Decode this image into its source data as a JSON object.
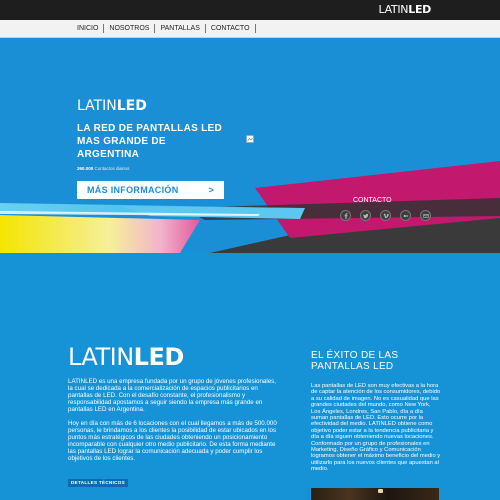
{
  "header": {
    "brand_light": "LATIN",
    "brand_bold": "LED",
    "nav": [
      "INICIO",
      "NOSOTROS",
      "PANTALLAS",
      "CONTACTO"
    ]
  },
  "hero": {
    "logo_light": "LATIN",
    "logo_bold": "LED",
    "title": "LA RED DE PANTALLAS LED MAS  GRANDE DE ARGENTINA",
    "counter_value": "260.000",
    "counter_label": "Contactos diarios",
    "more_button": "MÁS INFORMACIÓN",
    "more_arrow": ">"
  },
  "contact": {
    "title": "CONTACTO",
    "icons": [
      "facebook-icon",
      "twitter-icon",
      "vimeo-icon",
      "flickr-icon",
      "email-icon"
    ]
  },
  "about": {
    "logo_light": "LATIN",
    "logo_bold": "LED",
    "paragraph1": "LATINLED es una empresa fundada por un grupo de jóvenes profesionales, la cual se dedicada a la comercialización de espacios publicitarios en pantallas de LED. Con el desafío constante, el profesionalismo y responsabilidad apostamos a seguir siendo la empresa más grande en pantallas LED en Argentina.",
    "paragraph2": "Hoy en día con más de 6 locaciones con el cual llegamos a más de 500.000 personas, le brindamos a los clientes la posibilidad de estar ubicados en los puntos más estratégicos de las ciudades obteniendo un posicionamiento incomparable con cualquier otro medio publicitario. De esta forma mediante las pantallas LED lograr la comunicación adecuada y poder cumplir los objetivos de los clientes.",
    "details_button": "DETALLES TÉCNICOS"
  },
  "success": {
    "title": "EL ÉXITO DE LAS PANTALLAS LED",
    "text": "Las pantallas de LED son muy efectivas a la hora de captar la atención de los consumidores, debido a su calidad de imagen. No es casualidad que las grandes ciudades del mundo, como New York, Los Ángeles, Londres, San Pablo, día a día suman pantallas de LED. Esto ocurre por la efectividad del medio. LATINLED obtiene como objetivo poder estar a la tendencia publicitaria y día a día siguen obteniendo nuevas locaciones. Conformado por un grupo de profesionales en Marketing, Diseño Gráfico y Comunicación logramos obtener el máximo beneficio del medio y utilizarlo para los nuevos clientes que apuestan al medio."
  },
  "colors": {
    "background": "#1593d6",
    "topbar": "#1e1e1e",
    "magenta": "#c2186e",
    "yellow": "#f5e000",
    "cyan": "#2cb5e6",
    "dark": "#3a3a3a"
  }
}
